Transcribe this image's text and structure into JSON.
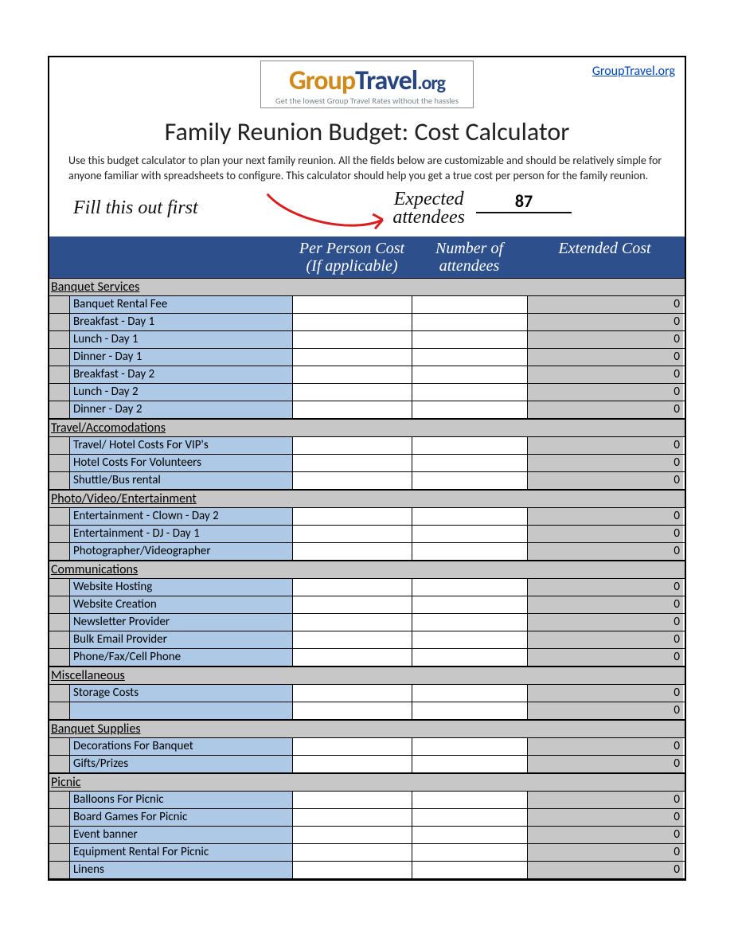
{
  "link_text": "GroupTravel.org",
  "logo": {
    "group": "Group",
    "travel": "Travel",
    "org": ".org",
    "tagline": "Get the lowest Group Travel Rates without the hassles"
  },
  "title": "Family Reunion Budget: Cost Calculator",
  "intro": "Use this budget calculator to plan your next family reunion. All the fields below are customizable and should be relatively simple for anyone familiar with spreadsheets to configure. This calculator should help you get a true cost per person for the family reunion.",
  "fill_first": "Fill this out first",
  "expected_line1": "Expected",
  "expected_line2": "attendees",
  "attendees_value": "87",
  "cols": {
    "ppc1": "Per Person Cost",
    "ppc2": "(If applicable)",
    "att1": "Number of",
    "att2": "attendees",
    "ext": "Extended Cost"
  },
  "sections": [
    {
      "name": "Banquet Services",
      "items": [
        {
          "label": "Banquet Rental Fee",
          "ext": "0"
        },
        {
          "label": "Breakfast - Day 1",
          "ext": "0"
        },
        {
          "label": "Lunch - Day 1",
          "ext": "0"
        },
        {
          "label": "Dinner - Day 1",
          "ext": "0"
        },
        {
          "label": "Breakfast - Day 2",
          "ext": "0"
        },
        {
          "label": "Lunch - Day 2",
          "ext": "0"
        },
        {
          "label": "Dinner - Day 2",
          "ext": "0"
        }
      ]
    },
    {
      "name": "Travel/Accomodations",
      "items": [
        {
          "label": "Travel/ Hotel Costs For VIP's",
          "ext": "0"
        },
        {
          "label": "Hotel Costs For Volunteers",
          "ext": "0"
        },
        {
          "label": "Shuttle/Bus rental",
          "ext": "0"
        }
      ]
    },
    {
      "name": "Photo/Video/Entertainment",
      "items": [
        {
          "label": "Entertainment - Clown - Day 2",
          "ext": "0"
        },
        {
          "label": "Entertainment - DJ - Day 1",
          "ext": "0"
        },
        {
          "label": "Photographer/Videographer",
          "ext": "0"
        }
      ]
    },
    {
      "name": "Communications",
      "items": [
        {
          "label": "Website Hosting",
          "ext": "0"
        },
        {
          "label": "Website Creation",
          "ext": "0"
        },
        {
          "label": "Newsletter Provider",
          "ext": "0"
        },
        {
          "label": "Bulk Email Provider",
          "ext": "0"
        },
        {
          "label": "Phone/Fax/Cell Phone",
          "ext": "0"
        }
      ]
    },
    {
      "name": "Miscellaneous",
      "items": [
        {
          "label": "Storage Costs",
          "ext": "0"
        },
        {
          "label": "",
          "ext": "0"
        }
      ]
    },
    {
      "name": "Banquet Supplies",
      "items": [
        {
          "label": "Decorations For Banquet",
          "ext": "0"
        },
        {
          "label": "Gifts/Prizes",
          "ext": "0"
        }
      ]
    },
    {
      "name": "Picnic",
      "items": [
        {
          "label": "Balloons For Picnic",
          "ext": "0"
        },
        {
          "label": "Board Games For Picnic",
          "ext": "0"
        },
        {
          "label": "Event banner",
          "ext": "0"
        },
        {
          "label": "Equipment Rental For Picnic",
          "ext": "0"
        },
        {
          "label": "Linens",
          "ext": "0"
        }
      ]
    }
  ]
}
